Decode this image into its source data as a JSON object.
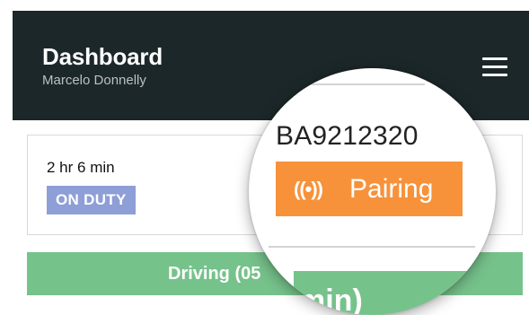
{
  "header": {
    "title": "Dashboard",
    "subtitle": "Marcelo Donnelly",
    "menu_icon": "hamburger-menu-icon"
  },
  "status_card": {
    "duration": "2 hr 6 min",
    "duty_status": "ON DUTY"
  },
  "driving_bar": {
    "label": "Driving (05"
  },
  "magnifier": {
    "device_serial": "BA9212320",
    "pairing_label": "Pairing",
    "pairing_icon_glyph": "((•))",
    "pairing_icon": "broadcast-icon",
    "partial_text": "min)"
  },
  "colors": {
    "header_bg": "#1c2729",
    "duty_badge": "#8e9ed6",
    "driving_green": "#76c28b",
    "pairing_orange": "#f7923b"
  }
}
